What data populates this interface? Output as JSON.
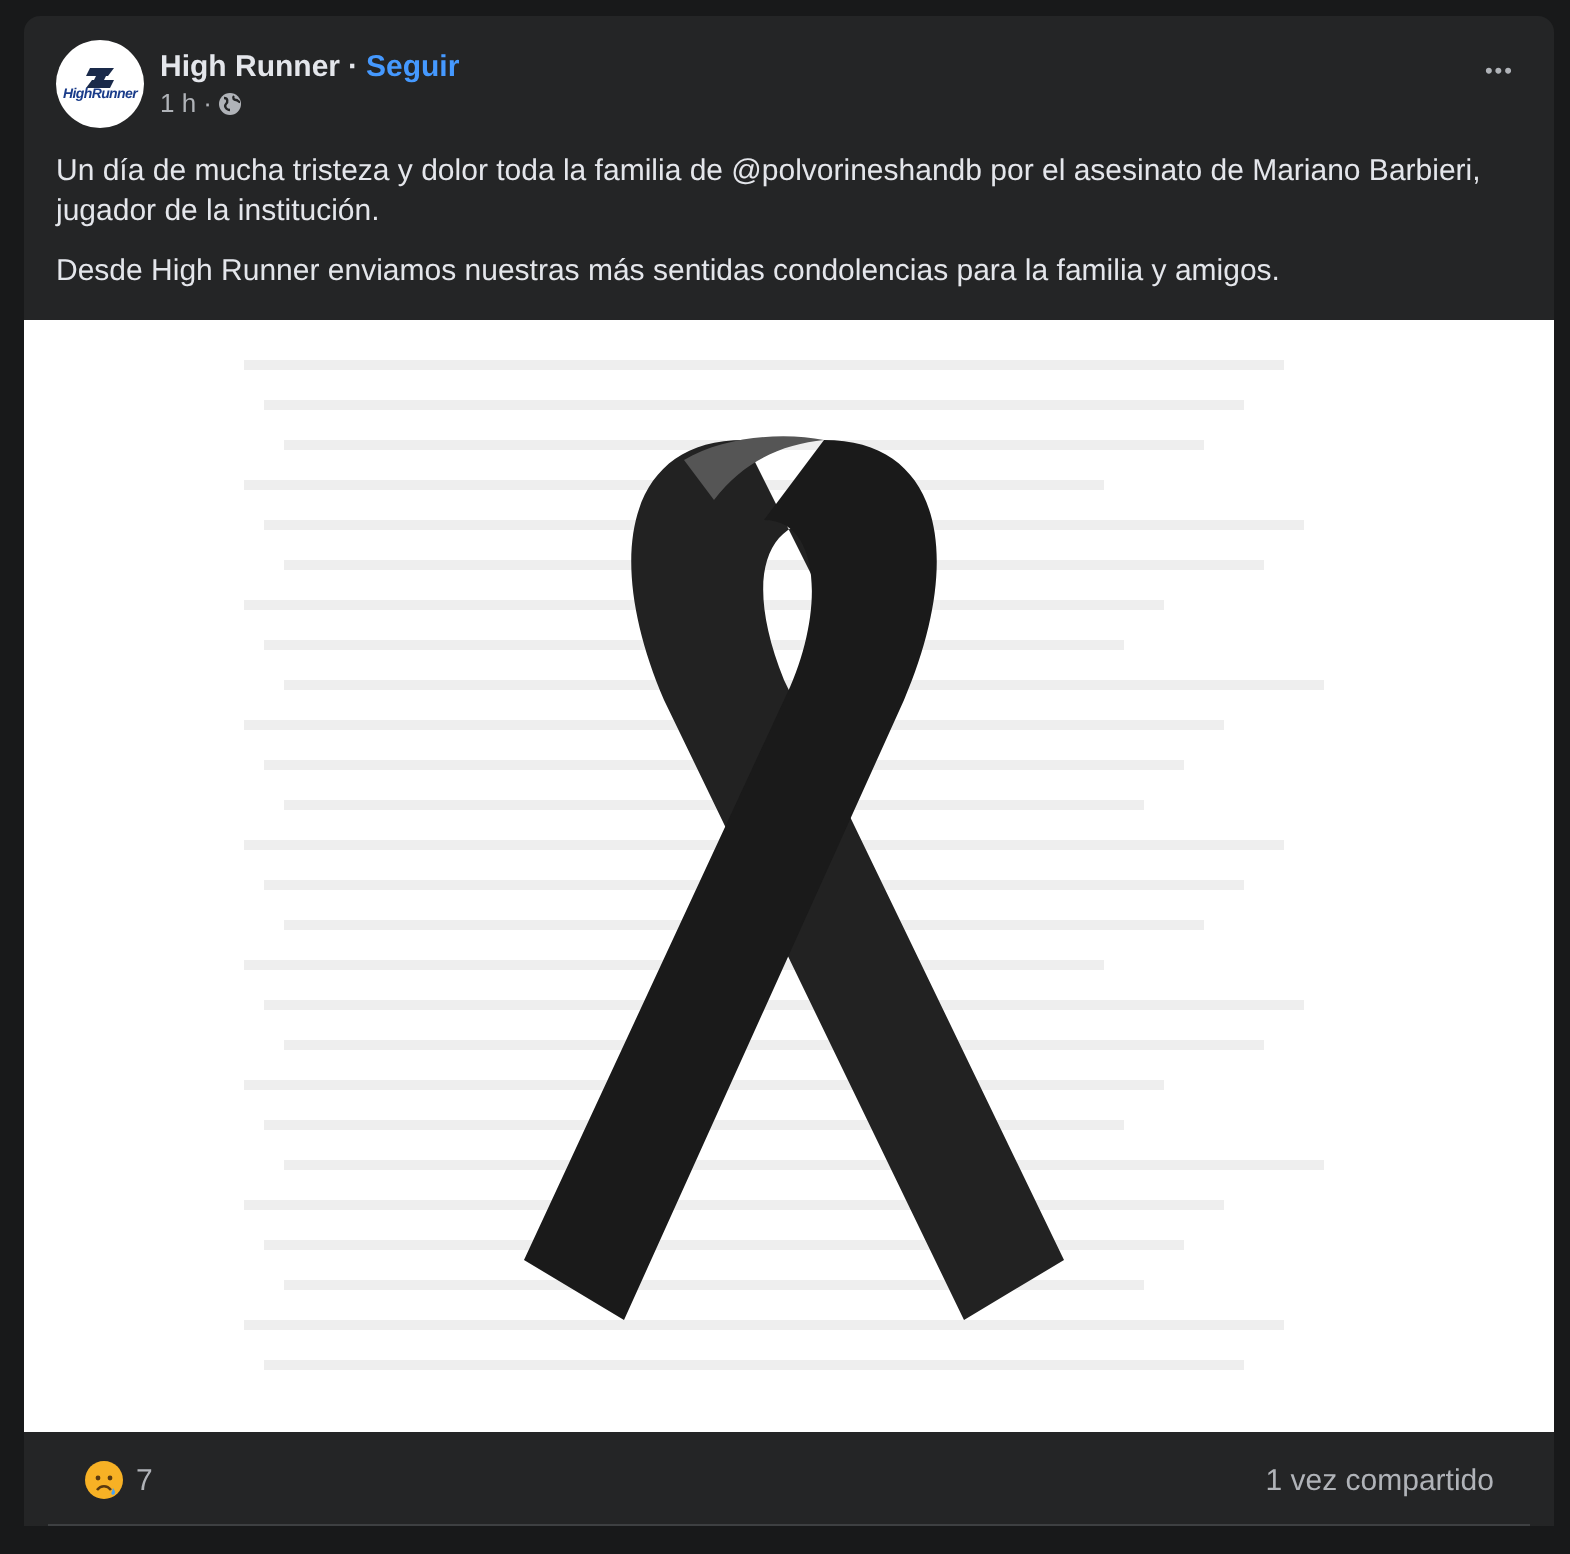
{
  "post": {
    "author": "High Runner",
    "separator": "·",
    "follow": "Seguir",
    "logo_text": "HighRunner",
    "time": "1 h ·",
    "more": "•••",
    "paragraphs": [
      "Un día de mucha tristeza y dolor toda la familia de @polvorineshandb por el asesinato de Mariano Barbieri, jugador de la institución.",
      "Desde High Runner enviamos nuestras más sentidas condolencias para la familia y amigos."
    ],
    "reactions": {
      "count": "7"
    },
    "shares": "1 vez compartido"
  }
}
